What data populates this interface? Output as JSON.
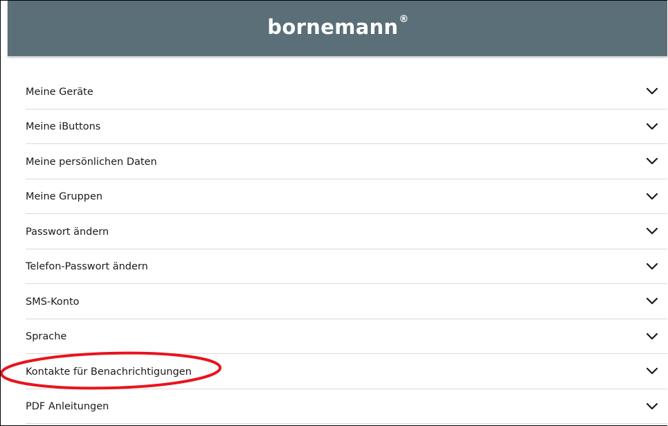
{
  "header": {
    "brand": "bornemann",
    "trademark": "®",
    "background_color": "#5a6f78"
  },
  "menu": {
    "items": [
      {
        "label": "Meine Geräte",
        "icon": "chevron-down-icon"
      },
      {
        "label": "Meine iButtons",
        "icon": "chevron-down-icon"
      },
      {
        "label": "Meine persönlichen Daten",
        "icon": "chevron-down-icon"
      },
      {
        "label": "Meine Gruppen",
        "icon": "chevron-down-icon"
      },
      {
        "label": "Passwort ändern",
        "icon": "chevron-down-icon"
      },
      {
        "label": "Telefon-Passwort ändern",
        "icon": "chevron-down-icon"
      },
      {
        "label": "SMS-Konto",
        "icon": "chevron-down-icon"
      },
      {
        "label": "Sprache",
        "icon": "chevron-down-icon"
      },
      {
        "label": "Kontakte für Benachrichtigungen",
        "icon": "chevron-down-icon"
      },
      {
        "label": "PDF Anleitungen",
        "icon": "chevron-down-icon"
      }
    ]
  },
  "annotation": {
    "highlight_color": "#e8141c",
    "highlighted_item": "Kontakte für Benachrichtigungen"
  }
}
